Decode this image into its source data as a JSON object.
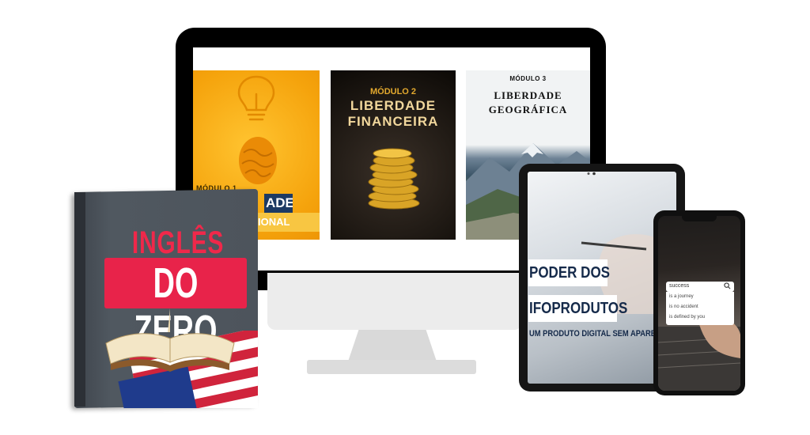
{
  "monitor": {
    "module1": {
      "label": "MÓDULO 1",
      "tag1": "ADE",
      "tag2": "IONAL"
    },
    "module2": {
      "label": "MÓDULO 2",
      "title_line1": "LIBERDADE",
      "title_line2": "FINANCEIRA"
    },
    "module3": {
      "label": "MÓDULO 3",
      "title_line1": "LIBERDADE",
      "title_line2": "GEOGRÁFICA"
    }
  },
  "book": {
    "title_line1": "INGLÊS",
    "title_line2": "DO ZERO"
  },
  "tablet": {
    "title_line1": "PODER DOS",
    "title_line2": "IFOPRODUTOS",
    "subtitle": "UM PRODUTO DIGITAL SEM APARECER"
  },
  "phone": {
    "search_value": "success",
    "suggestions": [
      "is a journey",
      "is no accident",
      "is defined by you"
    ]
  },
  "colors": {
    "module1_bg": "#f5a30c",
    "module2_gold": "#e3a92e",
    "book_red": "#e8234a",
    "tablet_navy": "#152a4a"
  }
}
